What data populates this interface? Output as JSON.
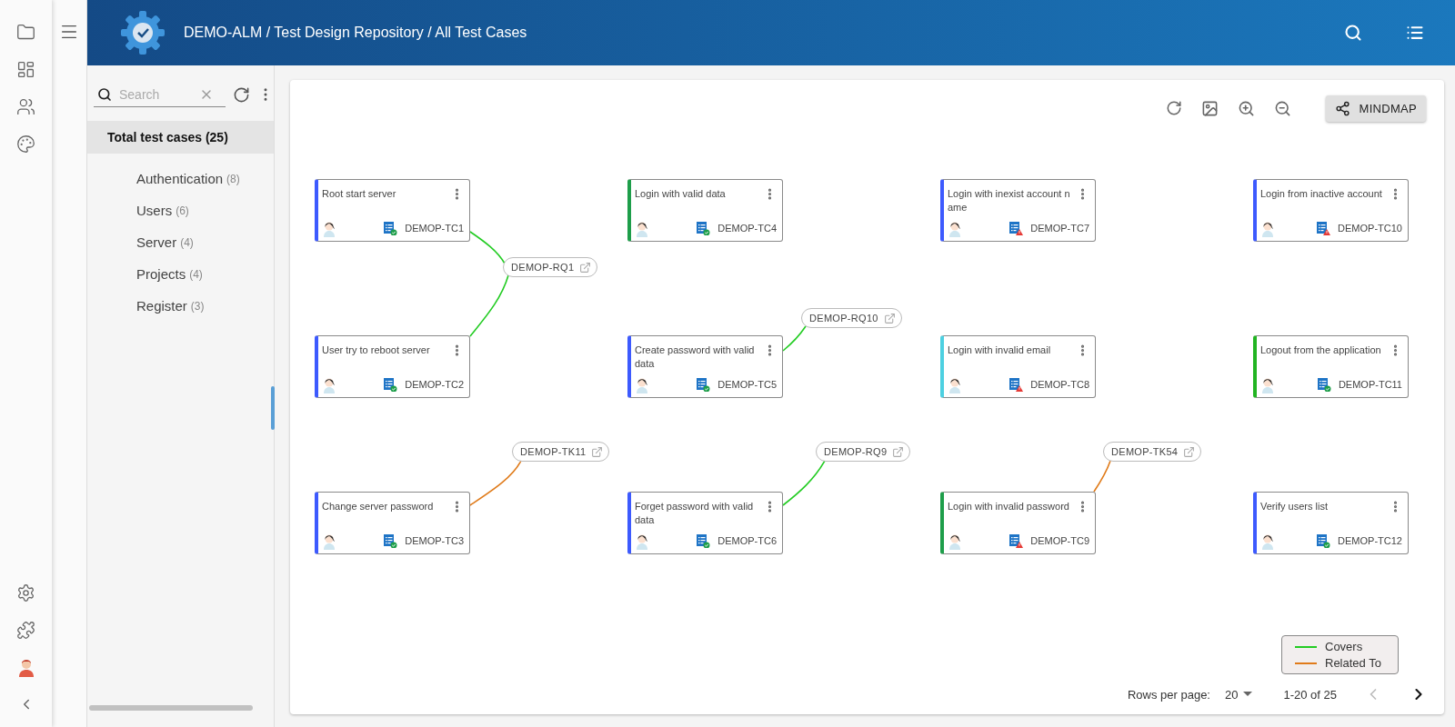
{
  "breadcrumb": "DEMO-ALM / Test Design Repository / All Test Cases",
  "search": {
    "placeholder": "Search"
  },
  "tree": {
    "label": "Total test cases (25)",
    "selected": true,
    "children": [
      {
        "label": "Authentication",
        "count": "(8)",
        "selected": false
      },
      {
        "label": "Users",
        "count": "(6)",
        "selected": false
      },
      {
        "label": "Server",
        "count": "(4)",
        "selected": false
      },
      {
        "label": "Projects",
        "count": "(4)",
        "selected": false
      },
      {
        "label": "Register",
        "count": "(3)",
        "selected": false
      }
    ]
  },
  "toolbar": {
    "mode_button": "MINDMAP"
  },
  "nodes": [
    {
      "title": "Root start server",
      "id": "DEMOP-TC1",
      "color": "#3d5afe",
      "kind": "pass"
    },
    {
      "title": "Login with valid data",
      "id": "DEMOP-TC4",
      "color": "#1e9e4a",
      "kind": "pass"
    },
    {
      "title": "Login with inexist account name",
      "id": "DEMOP-TC7",
      "color": "#3d5afe",
      "kind": "fail"
    },
    {
      "title": "Login from inactive account",
      "id": "DEMOP-TC10",
      "color": "#3d5afe",
      "kind": "fail"
    },
    {
      "title": "User try to reboot server",
      "id": "DEMOP-TC2",
      "color": "#3d5afe",
      "kind": "pass"
    },
    {
      "title": "Create password with valid data",
      "id": "DEMOP-TC5",
      "color": "#3d5afe",
      "kind": "pass"
    },
    {
      "title": "Login with invalid email",
      "id": "DEMOP-TC8",
      "color": "#4dd0e1",
      "kind": "fail"
    },
    {
      "title": "Logout from the application",
      "id": "DEMOP-TC11",
      "color": "#22b422",
      "kind": "pass"
    },
    {
      "title": "Change server password",
      "id": "DEMOP-TC3",
      "color": "#3d5afe",
      "kind": "pass"
    },
    {
      "title": "Forget password with valid data",
      "id": "DEMOP-TC6",
      "color": "#3d5afe",
      "kind": "pass"
    },
    {
      "title": "Login with invalid password",
      "id": "DEMOP-TC9",
      "color": "#1e9e4a",
      "kind": "fail"
    },
    {
      "title": "Verify users list",
      "id": "DEMOP-TC12",
      "color": "#3d5afe",
      "kind": "pass"
    }
  ],
  "links": [
    {
      "label": "DEMOP-RQ1",
      "kind": "covers"
    },
    {
      "label": "DEMOP-RQ10",
      "kind": "covers"
    },
    {
      "label": "DEMOP-TK11",
      "kind": "related"
    },
    {
      "label": "DEMOP-RQ9",
      "kind": "covers"
    },
    {
      "label": "DEMOP-TK54",
      "kind": "related"
    }
  ],
  "legend": [
    {
      "label": "Covers",
      "kind": "covers",
      "color": "#22cc22"
    },
    {
      "label": "Related To",
      "kind": "related",
      "color": "#e07b1a"
    }
  ],
  "pagination": {
    "rows_label": "Rows per page:",
    "rows_value": "20",
    "range": "1-20 of 25",
    "previous_disabled": true,
    "next_disabled": false
  }
}
